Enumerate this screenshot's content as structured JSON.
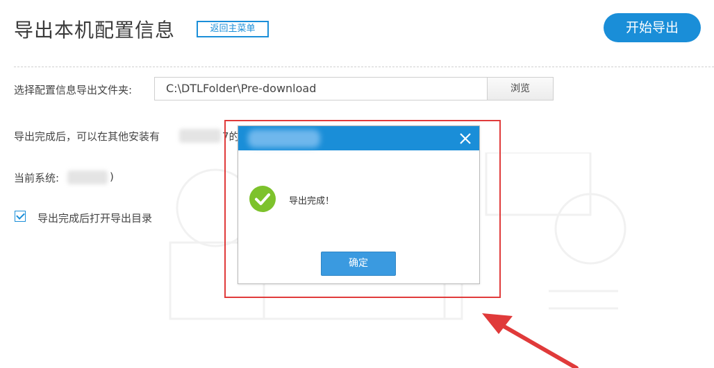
{
  "page": {
    "title": "导出本机配置信息",
    "back_button": "返回主菜单",
    "start_button": "开始导出"
  },
  "form": {
    "folder_label": "选择配置信息导出文件夹:",
    "folder_path": "C:\\DTLFolder\\Pre-download",
    "browse_button": "浏览",
    "hint_text": "导出完成后，可以在其他安装有",
    "hint_tail": "7的",
    "system_label": "当前系统:",
    "system_tail": ")",
    "open_dir_checkbox_label": "导出完成后打开导出目录",
    "open_dir_checked": true
  },
  "dialog": {
    "message": "导出完成！",
    "confirm_button": "确定"
  },
  "colors": {
    "accent": "#1a8ed8",
    "success": "#7dc22c",
    "annotation": "#e03a3a"
  },
  "icons": [
    "close-icon",
    "check-circle-icon",
    "checkbox-checked-icon",
    "arrow-annotation"
  ]
}
